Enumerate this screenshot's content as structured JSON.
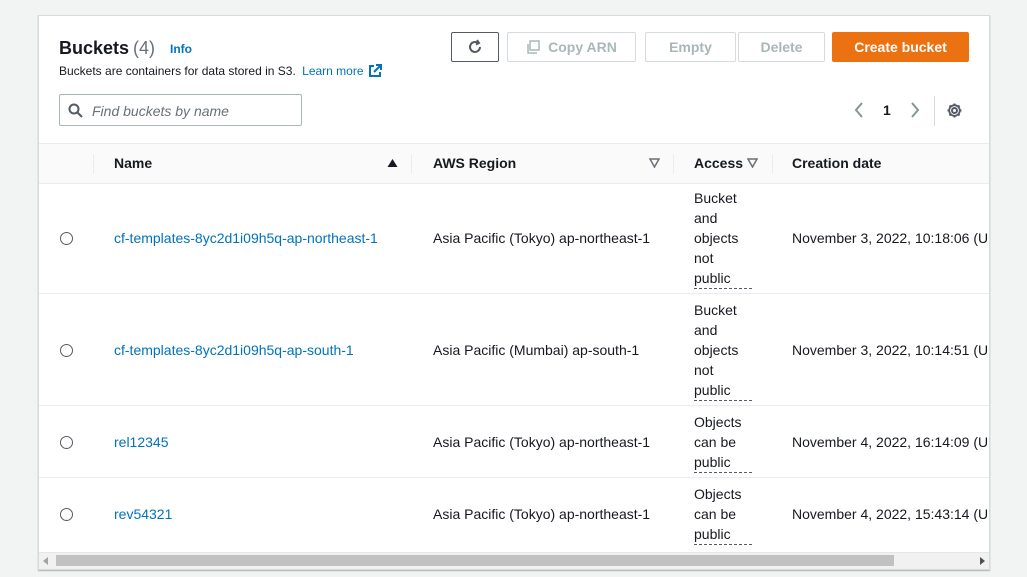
{
  "header": {
    "title": "Buckets",
    "count": "(4)",
    "info": "Info",
    "description": "Buckets are containers for data stored in S3.",
    "learn_more": "Learn more"
  },
  "toolbar": {
    "copy_arn": "Copy ARN",
    "empty": "Empty",
    "delete": "Delete",
    "create_bucket": "Create bucket"
  },
  "search": {
    "placeholder": "Find buckets by name"
  },
  "pagination": {
    "current_page": "1"
  },
  "columns": {
    "name": "Name",
    "region": "AWS Region",
    "access": "Access",
    "created": "Creation date"
  },
  "rows": [
    {
      "name": "cf-templates-8yc2d1i09h5q-ap-northeast-1",
      "region": "Asia Pacific (Tokyo) ap-northeast-1",
      "access_lines": [
        "Bucket",
        "and",
        "objects",
        "not",
        "public"
      ],
      "created": "November 3, 2022, 10:18:06 (U"
    },
    {
      "name": "cf-templates-8yc2d1i09h5q-ap-south-1",
      "region": "Asia Pacific (Mumbai) ap-south-1",
      "access_lines": [
        "Bucket",
        "and",
        "objects",
        "not",
        "public"
      ],
      "created": "November 3, 2022, 10:14:51 (U"
    },
    {
      "name": "rel12345",
      "region": "Asia Pacific (Tokyo) ap-northeast-1",
      "access_lines": [
        "Objects",
        "can be",
        "public"
      ],
      "created": "November 4, 2022, 16:14:09 (U"
    },
    {
      "name": "rev54321",
      "region": "Asia Pacific (Tokyo) ap-northeast-1",
      "access_lines": [
        "Objects",
        "can be",
        "public"
      ],
      "created": "November 4, 2022, 15:43:14 (U"
    }
  ],
  "colors": {
    "accent_orange": "#ec7211",
    "link_blue": "#0073bb"
  },
  "icons": [
    "refresh-icon",
    "copy-icon",
    "search-icon",
    "external-link-icon",
    "chevron-left-icon",
    "chevron-right-icon",
    "gear-icon",
    "sort-up-icon",
    "sort-down-icon"
  ]
}
